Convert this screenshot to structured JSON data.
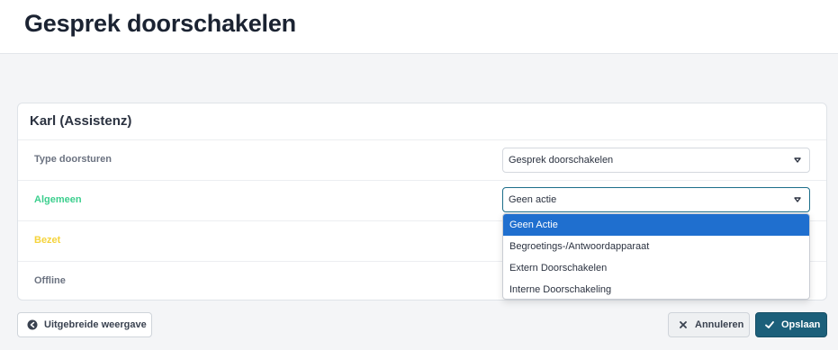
{
  "header": {
    "title": "Gesprek doorschakelen"
  },
  "card": {
    "title": "Karl (Assistenz)",
    "rows": [
      {
        "label": "Type doorsturen",
        "value": "Gesprek doorschakelen"
      },
      {
        "label": "Algemeen",
        "value": "Geen actie"
      },
      {
        "label": "Bezet"
      },
      {
        "label": "Offline"
      }
    ]
  },
  "dropdown": {
    "options": [
      "Geen Actie",
      "Begroetings-/Antwoordapparaat",
      "Extern Doorschakelen",
      "Interne Doorschakeling"
    ],
    "selected_index": 0
  },
  "footer": {
    "expand_label": "Uitgebreide weergave",
    "cancel_label": "Annuleren",
    "save_label": "Opslaan"
  },
  "colors": {
    "algemeen": "#3ccf8e",
    "bezet": "#f5d33b",
    "selected_option": "#1f6fcf",
    "primary_button": "#1c5f7a"
  }
}
